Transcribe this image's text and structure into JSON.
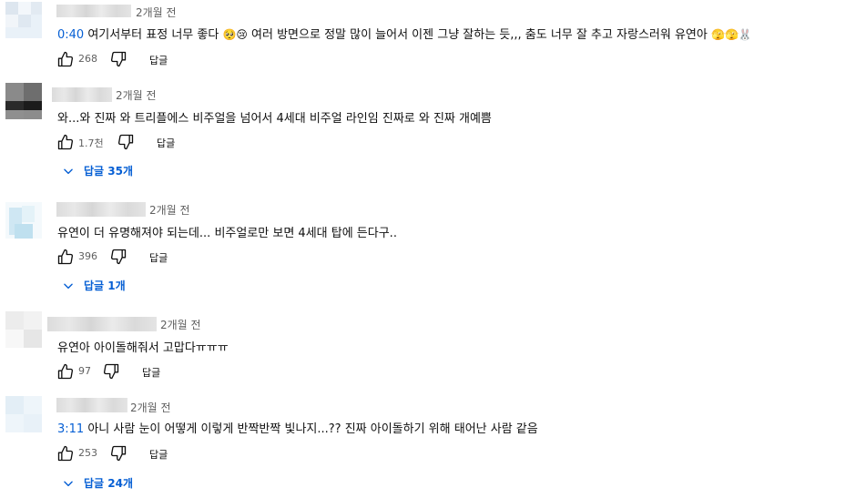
{
  "comments": [
    {
      "time": "2개월 전",
      "timestamp": "0:40",
      "text": " 여기서부터 표정 너무 좋다 ",
      "text_after": " 여러 방면으로 정말 많이 늘어서 이젠 그냥 잘하는 듯,,, 춤도 너무 잘 추고 자랑스러워 유연아 ",
      "likes": "268",
      "reply_label": "답글"
    },
    {
      "time": "2개월 전",
      "text": "와...와 진짜 와 트리플에스 비주얼을 넘어서 4세대 비주얼 라인임 진짜로 와 진짜 개예쁨",
      "likes": "1.7천",
      "reply_label": "답글",
      "replies_label": "답글 35개"
    },
    {
      "time": "2개월 전",
      "text": "유연이 더 유명해져야 되는데... 비주얼로만 보면 4세대 탑에 든다구..",
      "likes": "396",
      "reply_label": "답글",
      "replies_label": "답글 1개"
    },
    {
      "time": "2개월 전",
      "text": "유연아 아이돌해줘서 고맙다ㅠㅠㅠ",
      "likes": "97",
      "reply_label": "답글"
    },
    {
      "time": "2개월 전",
      "timestamp": "3:11",
      "text": " 아니 사람 눈이 어떻게 이렇게 반짝반짝 빛나지...?? 진짜 아이돌하기 위해 태어난 사람 같음",
      "likes": "253",
      "reply_label": "답글",
      "replies_label": "답글 24개"
    }
  ],
  "colors": {
    "link": "#065fd4",
    "meta": "#606060",
    "text": "#0f0f0f"
  },
  "icons": [
    "thumbs-up-icon",
    "thumbs-down-icon",
    "chevron-down-icon"
  ]
}
